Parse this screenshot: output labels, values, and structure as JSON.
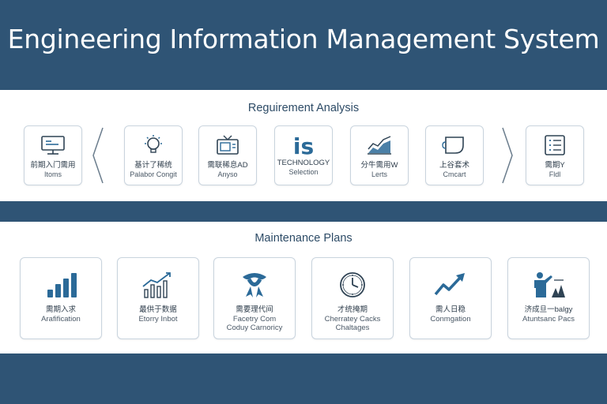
{
  "header": {
    "title": "Engineering Information Management System"
  },
  "requirements": {
    "title": "Reguirement Analysis",
    "cards": [
      {
        "icon": "monitor-icon",
        "line1": "前期入门需用",
        "line2": "Itoms"
      },
      {
        "icon": "lightbulb-icon",
        "line1": "基计了稀统",
        "line2": "Palabor Congit"
      },
      {
        "icon": "tv-icon",
        "line1": "需联稀息AD",
        "line2": "Anyso"
      },
      {
        "icon": "is-text-icon",
        "icon_text": "is",
        "line1": "TECHNOLOGY",
        "line2": "Selection"
      },
      {
        "icon": "area-chart-icon",
        "line1": "分牛需用W",
        "line2": "Lerts"
      },
      {
        "icon": "document-icon",
        "line1": "上谷套术",
        "line2": "Cmcart"
      },
      {
        "icon": "checklist-icon",
        "line1": "需期Y",
        "line2": "Fldl"
      }
    ]
  },
  "maintenance": {
    "title": "Maintenance Plans",
    "cards": [
      {
        "icon": "bar-chart-icon",
        "line1": "需期入求",
        "line2": "Arafification"
      },
      {
        "icon": "growth-chart-icon",
        "line1": "最供于数据",
        "line2": "Etorry Inbot"
      },
      {
        "icon": "ribbon-icon",
        "line1": "需要理代间",
        "line2": "Facetry Com\nCoduy Carnoricy"
      },
      {
        "icon": "clock-icon",
        "line1": "才统掩期",
        "line2": "Cherratey Cacks\nChaltages"
      },
      {
        "icon": "trend-arrow-icon",
        "line1": "需人日稳",
        "line2": "Conmgation"
      },
      {
        "icon": "presenter-icon",
        "line1": "济成旦一balgy",
        "line2": "Atuntsanc Pacs"
      }
    ]
  },
  "colors": {
    "navy": "#2f5475",
    "icon_blue": "#2b6a98",
    "icon_dark": "#2f4354"
  }
}
